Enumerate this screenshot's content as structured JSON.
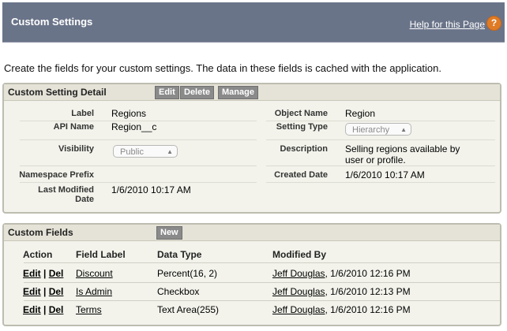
{
  "header": {
    "title": "Custom Settings",
    "help_link": "Help for this Page",
    "help_icon": "?"
  },
  "intro_text": "Create the fields for your custom settings. The data in these fields is cached with the application.",
  "detail": {
    "title": "Custom Setting Detail",
    "buttons": {
      "edit": "Edit",
      "delete": "Delete",
      "manage": "Manage"
    },
    "label_label": "Label",
    "label_value": "Regions",
    "object_name_label": "Object Name",
    "object_name_value": "Region",
    "api_name_label": "API Name",
    "api_name_value": "Region__c",
    "setting_type_label": "Setting Type",
    "setting_type_value": "Hierarchy",
    "visibility_label": "Visibility",
    "visibility_value": "Public",
    "description_label": "Description",
    "description_line1": "Selling regions available by",
    "description_line2": "user or profile.",
    "namespace_label": "Namespace Prefix",
    "created_date_label": "Created Date",
    "created_date_value": "1/6/2010 10:17 AM",
    "last_modified_label_line1": "Last Modified",
    "last_modified_label_line2": "Date",
    "last_modified_value": "1/6/2010 10:17 AM"
  },
  "fields": {
    "title": "Custom Fields",
    "new_button": "New",
    "columns": [
      "Action",
      "Field Label",
      "Data Type",
      "Modified By"
    ],
    "edit_label": "Edit",
    "del_label": "Del",
    "separator": "|",
    "rows": [
      {
        "label": "Discount",
        "type": "Percent(16, 2)",
        "modified_by": "Jeff Douglas",
        "modified_at": ", 1/6/2010 12:16 PM"
      },
      {
        "label": "Is Admin",
        "type": "Checkbox",
        "modified_by": "Jeff Douglas",
        "modified_at": ", 1/6/2010 12:13 PM"
      },
      {
        "label": "Terms",
        "type": "Text Area(255)",
        "modified_by": "Jeff Douglas",
        "modified_at": ", 1/6/2010 12:16 PM"
      }
    ]
  }
}
